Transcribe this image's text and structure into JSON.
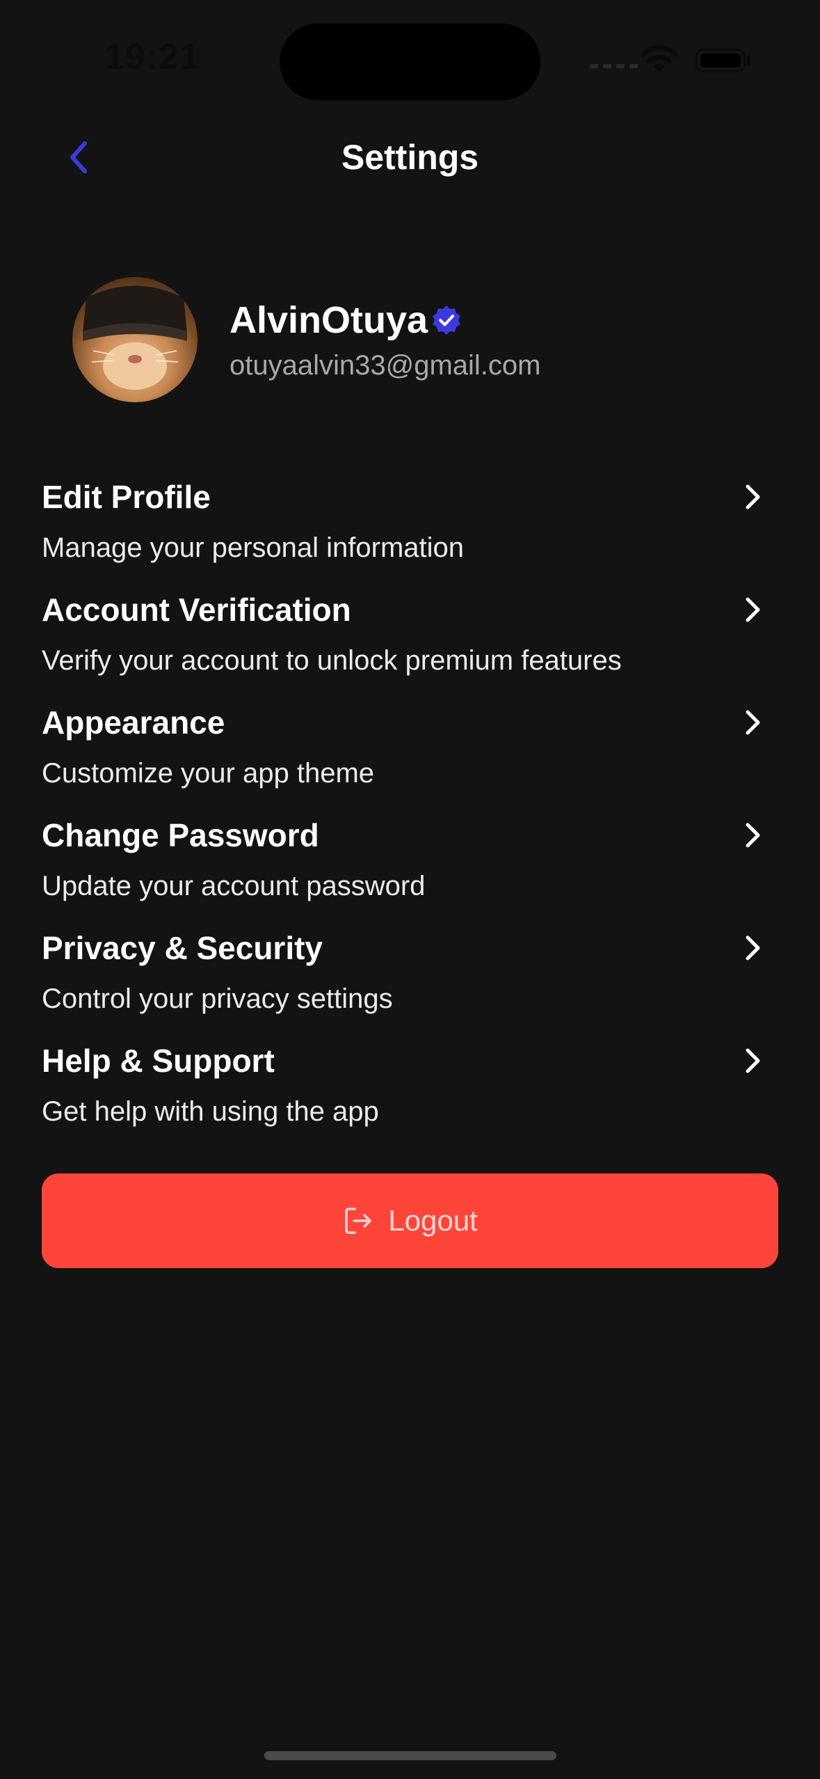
{
  "status_bar": {
    "time": "19:21"
  },
  "header": {
    "title": "Settings"
  },
  "profile": {
    "name": "AlvinOtuya",
    "email": "otuyaalvin33@gmail.com",
    "verified": true
  },
  "settings": [
    {
      "title": "Edit Profile",
      "subtitle": "Manage your personal information"
    },
    {
      "title": "Account Verification",
      "subtitle": "Verify your account to unlock premium features"
    },
    {
      "title": "Appearance",
      "subtitle": "Customize your app theme"
    },
    {
      "title": "Change Password",
      "subtitle": "Update your account password"
    },
    {
      "title": "Privacy & Security",
      "subtitle": "Control your privacy settings"
    },
    {
      "title": "Help & Support",
      "subtitle": "Get help with using the app"
    }
  ],
  "logout": {
    "label": "Logout",
    "icon": "logout-icon"
  },
  "colors": {
    "background": "#131313",
    "accent": "#3a3adf",
    "logout": "#ff453a",
    "secondary_text": "#a9a9a9"
  }
}
